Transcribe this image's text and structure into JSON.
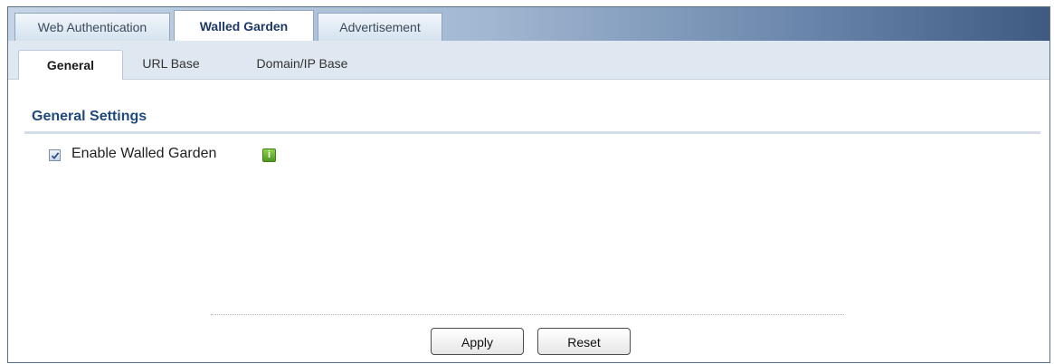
{
  "top_tabs": [
    {
      "label": "Web Authentication",
      "active": false
    },
    {
      "label": "Walled Garden",
      "active": true
    },
    {
      "label": "Advertisement",
      "active": false
    }
  ],
  "sub_tabs": [
    {
      "label": "General",
      "active": true
    },
    {
      "label": "URL Base",
      "active": false
    },
    {
      "label": "Domain/IP Base",
      "active": false
    }
  ],
  "general_settings": {
    "title": "General Settings",
    "enable_walled_garden": {
      "label": "Enable Walled Garden",
      "checked": true
    },
    "info_icon": "info-icon"
  },
  "buttons": {
    "apply": "Apply",
    "reset": "Reset"
  },
  "colors": {
    "section_title": "#1e4a7e",
    "info_icon": "#5aa82a",
    "tabbar_dark": "#3f5a81"
  }
}
